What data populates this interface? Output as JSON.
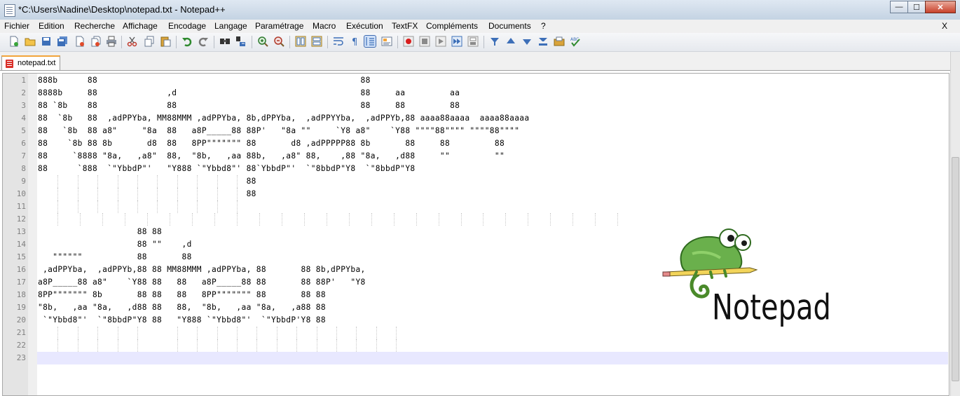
{
  "window": {
    "title": "*C:\\Users\\Nadine\\Desktop\\notepad.txt - Notepad++",
    "minimize_label": "—",
    "maximize_label": "☐",
    "close_label": "✕"
  },
  "menu": {
    "items": [
      "Fichier",
      "Edition",
      "Recherche",
      "Affichage",
      "Encodage",
      "Langage",
      "Paramétrage",
      "Macro",
      "Exécution",
      "TextFX",
      "Compléments",
      "Documents",
      "?"
    ],
    "close_label": "X"
  },
  "toolbar": {
    "icons": [
      "new-file-icon",
      "open-file-icon",
      "save-icon",
      "save-all-icon",
      "close-icon",
      "close-all-icon",
      "print-icon",
      "cut-icon",
      "copy-icon",
      "paste-icon",
      "undo-icon",
      "redo-icon",
      "find-icon",
      "replace-icon",
      "zoom-in-icon",
      "zoom-out-icon",
      "sync-vertical-icon",
      "sync-horizontal-icon",
      "word-wrap-icon",
      "show-all-chars-icon",
      "indent-guide-icon",
      "user-lang-icon",
      "record-macro-icon",
      "stop-record-icon",
      "play-macro-icon",
      "run-macro-multiple-icon",
      "save-macro-icon",
      "trim-icon",
      "move-up-icon",
      "move-down-icon",
      "sort-icon",
      "clipboard-icon",
      "spell-check-icon"
    ],
    "active_icon": "indent-guide-icon"
  },
  "tab": {
    "label": "notepad.txt",
    "accent_color": "#f2a43a"
  },
  "editor": {
    "current_line": 23,
    "line_numbers": [
      "1",
      "2",
      "3",
      "4",
      "5",
      "6",
      "7",
      "8",
      "9",
      "10",
      "11",
      "12",
      "13",
      "14",
      "15",
      "16",
      "17",
      "18",
      "19",
      "20",
      "21",
      "22",
      "23"
    ],
    "lines": [
      "888b      88                                                     88",
      "8888b     88              ,d                                     88     aa         aa",
      "88 `8b    88              88                                     88     88         88",
      "88  `8b   88  ,adPPYba, MM88MMM ,adPPYba, 8b,dPPYba,  ,adPPYYba,  ,adPPYb,88 aaaa88aaaa  aaaa88aaaa",
      "88   `8b  88 a8\"     \"8a  88   a8P_____88 88P'   \"8a \"\"     `Y8 a8\"    `Y88 \"\"\"\"88\"\"\"\" \"\"\"\"88\"\"\"\"",
      "88    `8b 88 8b       d8  88   8PP\"\"\"\"\"\"\" 88       d8 ,adPPPPP88 8b       88     88         88",
      "88     `8888 \"8a,   ,a8\"  88,  \"8b,   ,aa 88b,   ,a8\" 88,    ,88 \"8a,   ,d88     \"\"         \"\"",
      "88      `888  `\"YbbdP\"'   \"Y888 `\"Ybbd8\"' 88`YbbdP\"'  `\"8bbdP\"Y8  `\"8bbdP\"Y8",
      "                                          88",
      "                                          88",
      "",
      "",
      "                    88 88",
      "                    88 \"\"    ,d",
      "   \"\"\"\"\"\"           88       88",
      " ,adPPYba,  ,adPPYb,88 88 MM88MMM ,adPPYba, 88       88 8b,dPPYba,",
      "a8P_____88 a8\"    `Y88 88   88   a8P_____88 88       88 88P'   \"Y8",
      "8PP\"\"\"\"\"\"\" 8b       88 88   88   8PP\"\"\"\"\"\"\" 88       88 88",
      "\"8b,   ,aa \"8a,   ,d88 88   88,  \"8b,   ,aa \"8a,   ,a88 88",
      " `\"Ybbd8\"'  `\"8bbdP\"Y8 88   \"Y888 `\"Ybbd8\"'  `\"YbbdP'Y8 88",
      "",
      "",
      ""
    ]
  },
  "logo": {
    "text": "Notepad++",
    "body_color": "#6ab04c"
  }
}
